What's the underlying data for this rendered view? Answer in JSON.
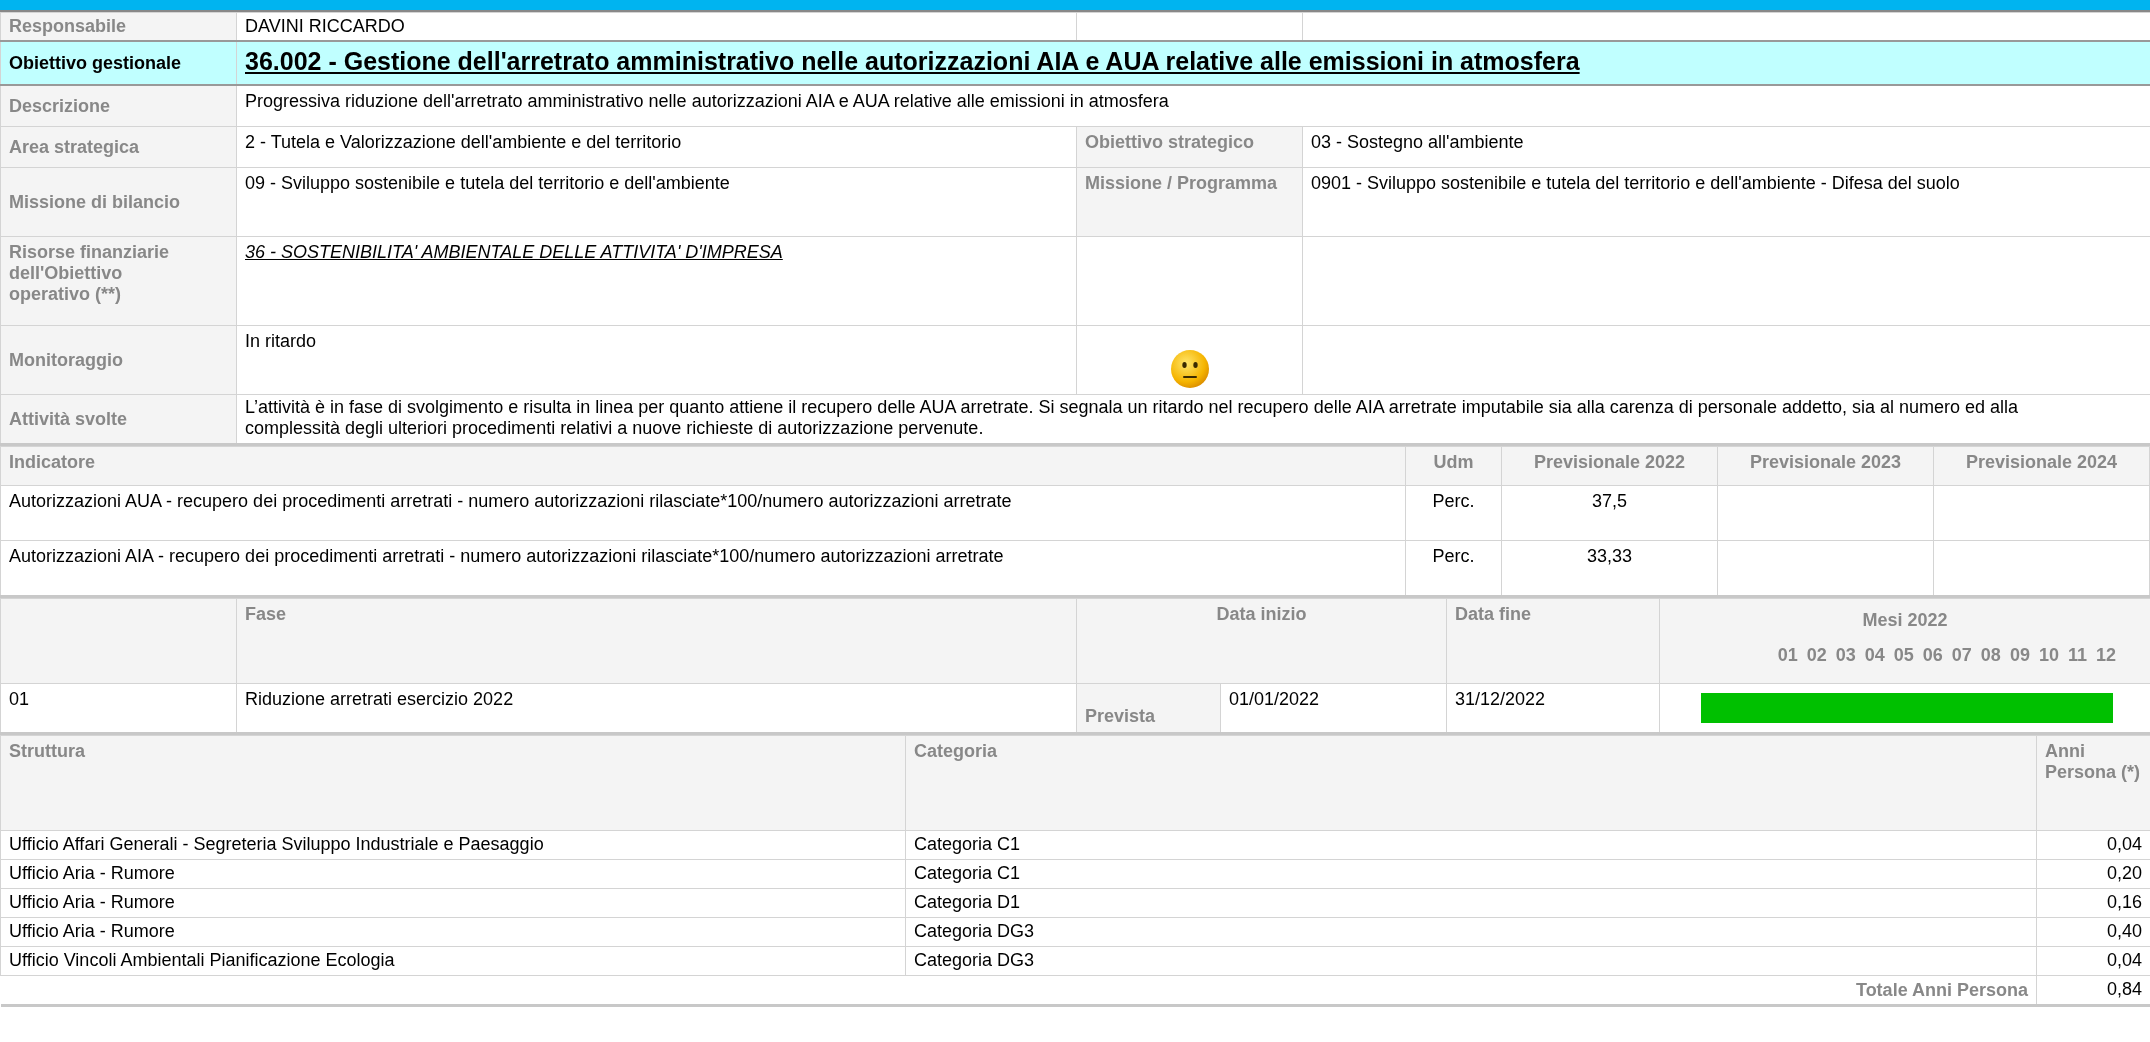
{
  "responsabile": {
    "label": "Responsabile",
    "value": "DAVINI RICCARDO"
  },
  "obiettivo_gestionale": {
    "label": "Obiettivo gestionale",
    "title": "36.002 - Gestione dell'arretrato amministrativo nelle autorizzazioni AIA e AUA relative alle emissioni in atmosfera"
  },
  "info_rows": [
    {
      "kind": "full",
      "label": "Descrizione",
      "value": "Progressiva riduzione dell'arretrato amministrativo nelle autorizzazioni AIA e AUA relative alle emissioni in atmosfera"
    },
    {
      "kind": "split",
      "label": "Area strategica",
      "value": "2 - Tutela e Valorizzazione dell'ambiente e del territorio",
      "side_label": "Obiettivo strategico",
      "side_value": "03 - Sostegno all'ambiente"
    },
    {
      "kind": "split",
      "label": "Missione di bilancio",
      "value": "09 - Sviluppo sostenibile e tutela del territorio e dell'ambiente",
      "side_label": "Missione / Programma",
      "side_value": "0901 - Sviluppo sostenibile e tutela del territorio e dell'ambiente - Difesa del suolo"
    },
    {
      "kind": "link",
      "label": "Risorse finanziarie dell'Obiettivo operativo (**)",
      "value": "36 - SOSTENIBILITA' AMBIENTALE DELLE ATTIVITA' D'IMPRESA"
    },
    {
      "kind": "monitor",
      "label": "Monitoraggio",
      "value": "In ritardo"
    },
    {
      "kind": "full",
      "label": "Attività svolte",
      "value": "L’attività è in fase di svolgimento e risulta in linea per quanto attiene il recupero delle AUA arretrate. Si segnala un ritardo nel recupero delle AIA arretrate imputabile sia alla carenza di personale addetto, sia al numero ed alla complessità degli ulteriori procedimenti relativi a nuove richieste di autorizzazione pervenute."
    }
  ],
  "indicatori": {
    "columns": [
      "Indicatore",
      "Udm",
      "Previsionale 2022",
      "Previsionale 2023",
      "Previsionale 2024"
    ],
    "rows": [
      {
        "indicatore": "Autorizzazioni AUA - recupero dei procedimenti arretrati - numero autorizzazioni rilasciate*100/numero autorizzazioni arretrate",
        "udm": "Perc.",
        "previsionale_2022": "37,5"
      },
      {
        "indicatore": "Autorizzazioni AIA - recupero dei procedimenti arretrati - numero autorizzazioni rilasciate*100/numero autorizzazioni arretrate",
        "udm": "Perc.",
        "previsionale_2022": "33,33"
      }
    ]
  },
  "fasi": {
    "columns": [
      "Fase",
      "Data inizio",
      "Data fine"
    ],
    "months_title": "Mesi 2022",
    "months": [
      "01",
      "02",
      "03",
      "04",
      "05",
      "06",
      "07",
      "08",
      "09",
      "10",
      "11",
      "12"
    ],
    "rows": [
      {
        "code": "01",
        "name": "Riduzione arretrati esercizio 2022",
        "type": "Prevista",
        "start": "01/01/2022",
        "end": "31/12/2022",
        "level": 1
      }
    ]
  },
  "strutture": {
    "columns": [
      "Struttura",
      "Categoria",
      "Anni Persona (*)"
    ],
    "rows": [
      {
        "struttura": "Ufficio Affari Generali - Segreteria Sviluppo Industriale e Paesaggio",
        "categoria": "Categoria C1",
        "anni": "0,04"
      },
      {
        "struttura": "Ufficio Aria - Rumore",
        "categoria": "Categoria C1",
        "anni": "0,20"
      },
      {
        "struttura": "Ufficio Aria - Rumore",
        "categoria": "Categoria D1",
        "anni": "0,16"
      },
      {
        "struttura": "Ufficio Aria - Rumore",
        "categoria": "Categoria DG3",
        "anni": "0,40"
      },
      {
        "struttura": "Ufficio Vincoli Ambientali Pianificazione Ecologia",
        "categoria": "Categoria DG3",
        "anni": "0,04"
      }
    ],
    "total": {
      "label": "Totale Anni Persona",
      "value": "0,84"
    }
  }
}
